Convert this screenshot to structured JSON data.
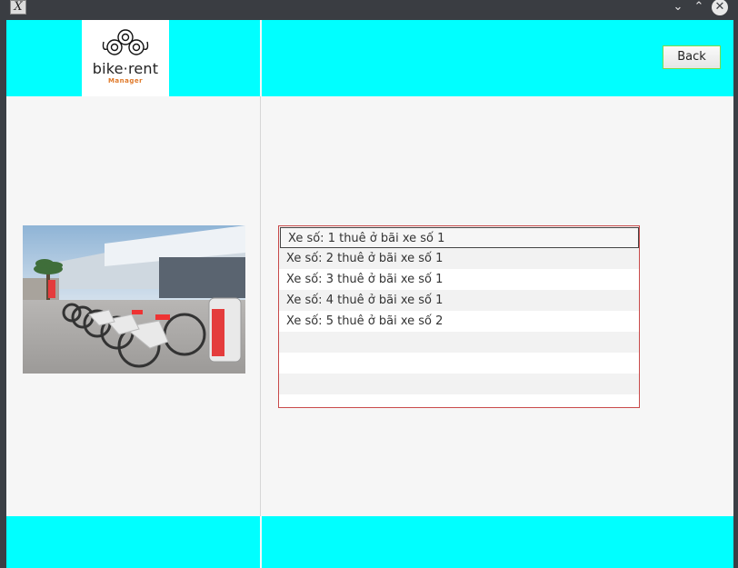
{
  "titlebar": {
    "app_icon_glyph": "X",
    "minimize_glyph": "⌄",
    "maximize_glyph": "⌃",
    "close_glyph": "✕"
  },
  "header": {
    "logo_text": "bike·rent",
    "logo_subtext": "Manager",
    "back_label": "Back"
  },
  "list": {
    "items": [
      "Xe số: 1 thuê ở bãi xe số 1",
      "Xe số: 2 thuê ở bãi xe số 1",
      "Xe số: 3 thuê ở bãi xe số 1",
      "Xe số: 4 thuê ở bãi xe số 1",
      "Xe số: 5 thuê ở bãi xe số 2"
    ],
    "selected_index": 0
  },
  "colors": {
    "header_bg": "#00ffff",
    "list_border": "#c94a4a",
    "button_border": "#7ed94a",
    "logo_accent": "#e07a2a"
  }
}
